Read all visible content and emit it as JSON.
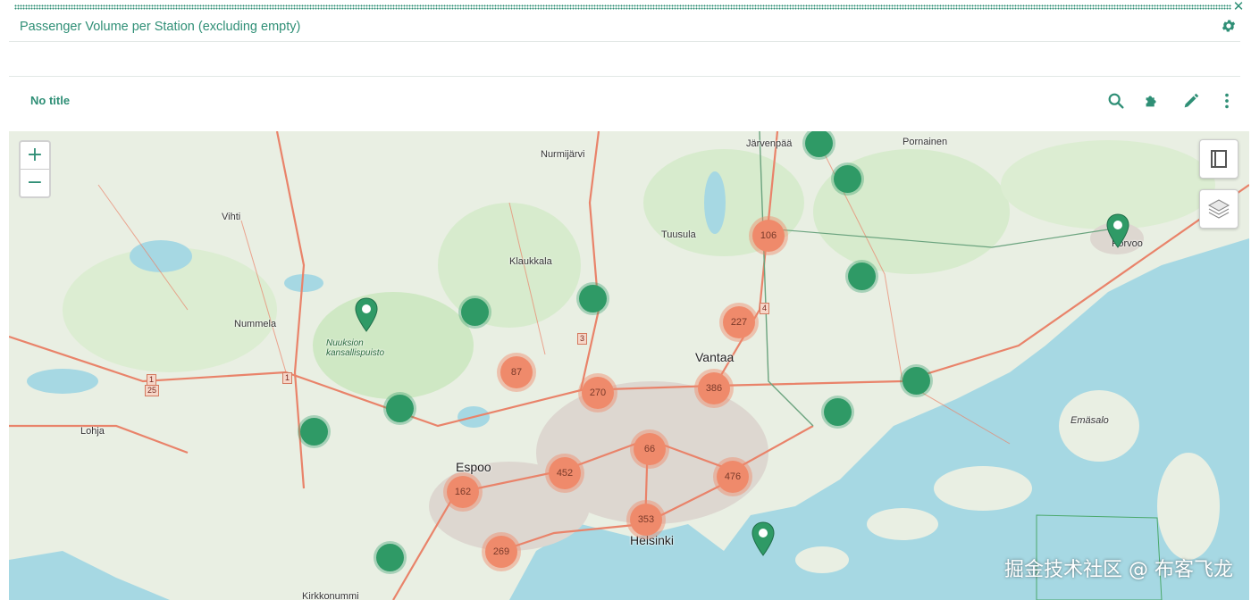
{
  "panel": {
    "title": "Passenger Volume per Station (excluding empty)",
    "close_symbol": "✕"
  },
  "map_header": {
    "title": "No title",
    "icons": [
      "search-icon",
      "puzzle-icon",
      "pencil-icon",
      "more-vertical-icon"
    ]
  },
  "map": {
    "zoom_in": "+",
    "zoom_out": "−",
    "controls": [
      "legend-book-icon",
      "layers-icon"
    ],
    "places": {
      "jarvenpaa": "Järvenpää",
      "pornainen": "Pornainen",
      "nurmijarvi": "Nurmijärvi",
      "vihti": "Vihti",
      "tuusula": "Tuusula",
      "klaukkala": "Klaukkala",
      "nummela": "Nummela",
      "nuuksion": "Nuuksion kansallispuisto",
      "vantaa": "Vantaa",
      "lohja": "Lohja",
      "espoo": "Espoo",
      "helsinki": "Helsinki",
      "porvoo": "Porvoo",
      "emasalo": "Emäsalo",
      "kirkkonummi": "Kirkkonummi"
    },
    "clusters": [
      {
        "count": "106"
      },
      {
        "count": "227"
      },
      {
        "count": "87"
      },
      {
        "count": "270"
      },
      {
        "count": "386"
      },
      {
        "count": "66"
      },
      {
        "count": "452"
      },
      {
        "count": "476"
      },
      {
        "count": "162"
      },
      {
        "count": "353"
      },
      {
        "count": "269"
      }
    ],
    "road_shields": [
      "4",
      "3",
      "1",
      "1",
      "25"
    ],
    "colors": {
      "cluster": "#ef8a6b",
      "station": "#2f9a66",
      "accent": "#2f8f76",
      "water": "#a6d8e3",
      "land": "#e9efe3"
    }
  },
  "watermark": "掘金技术社区 @ 布客飞龙"
}
